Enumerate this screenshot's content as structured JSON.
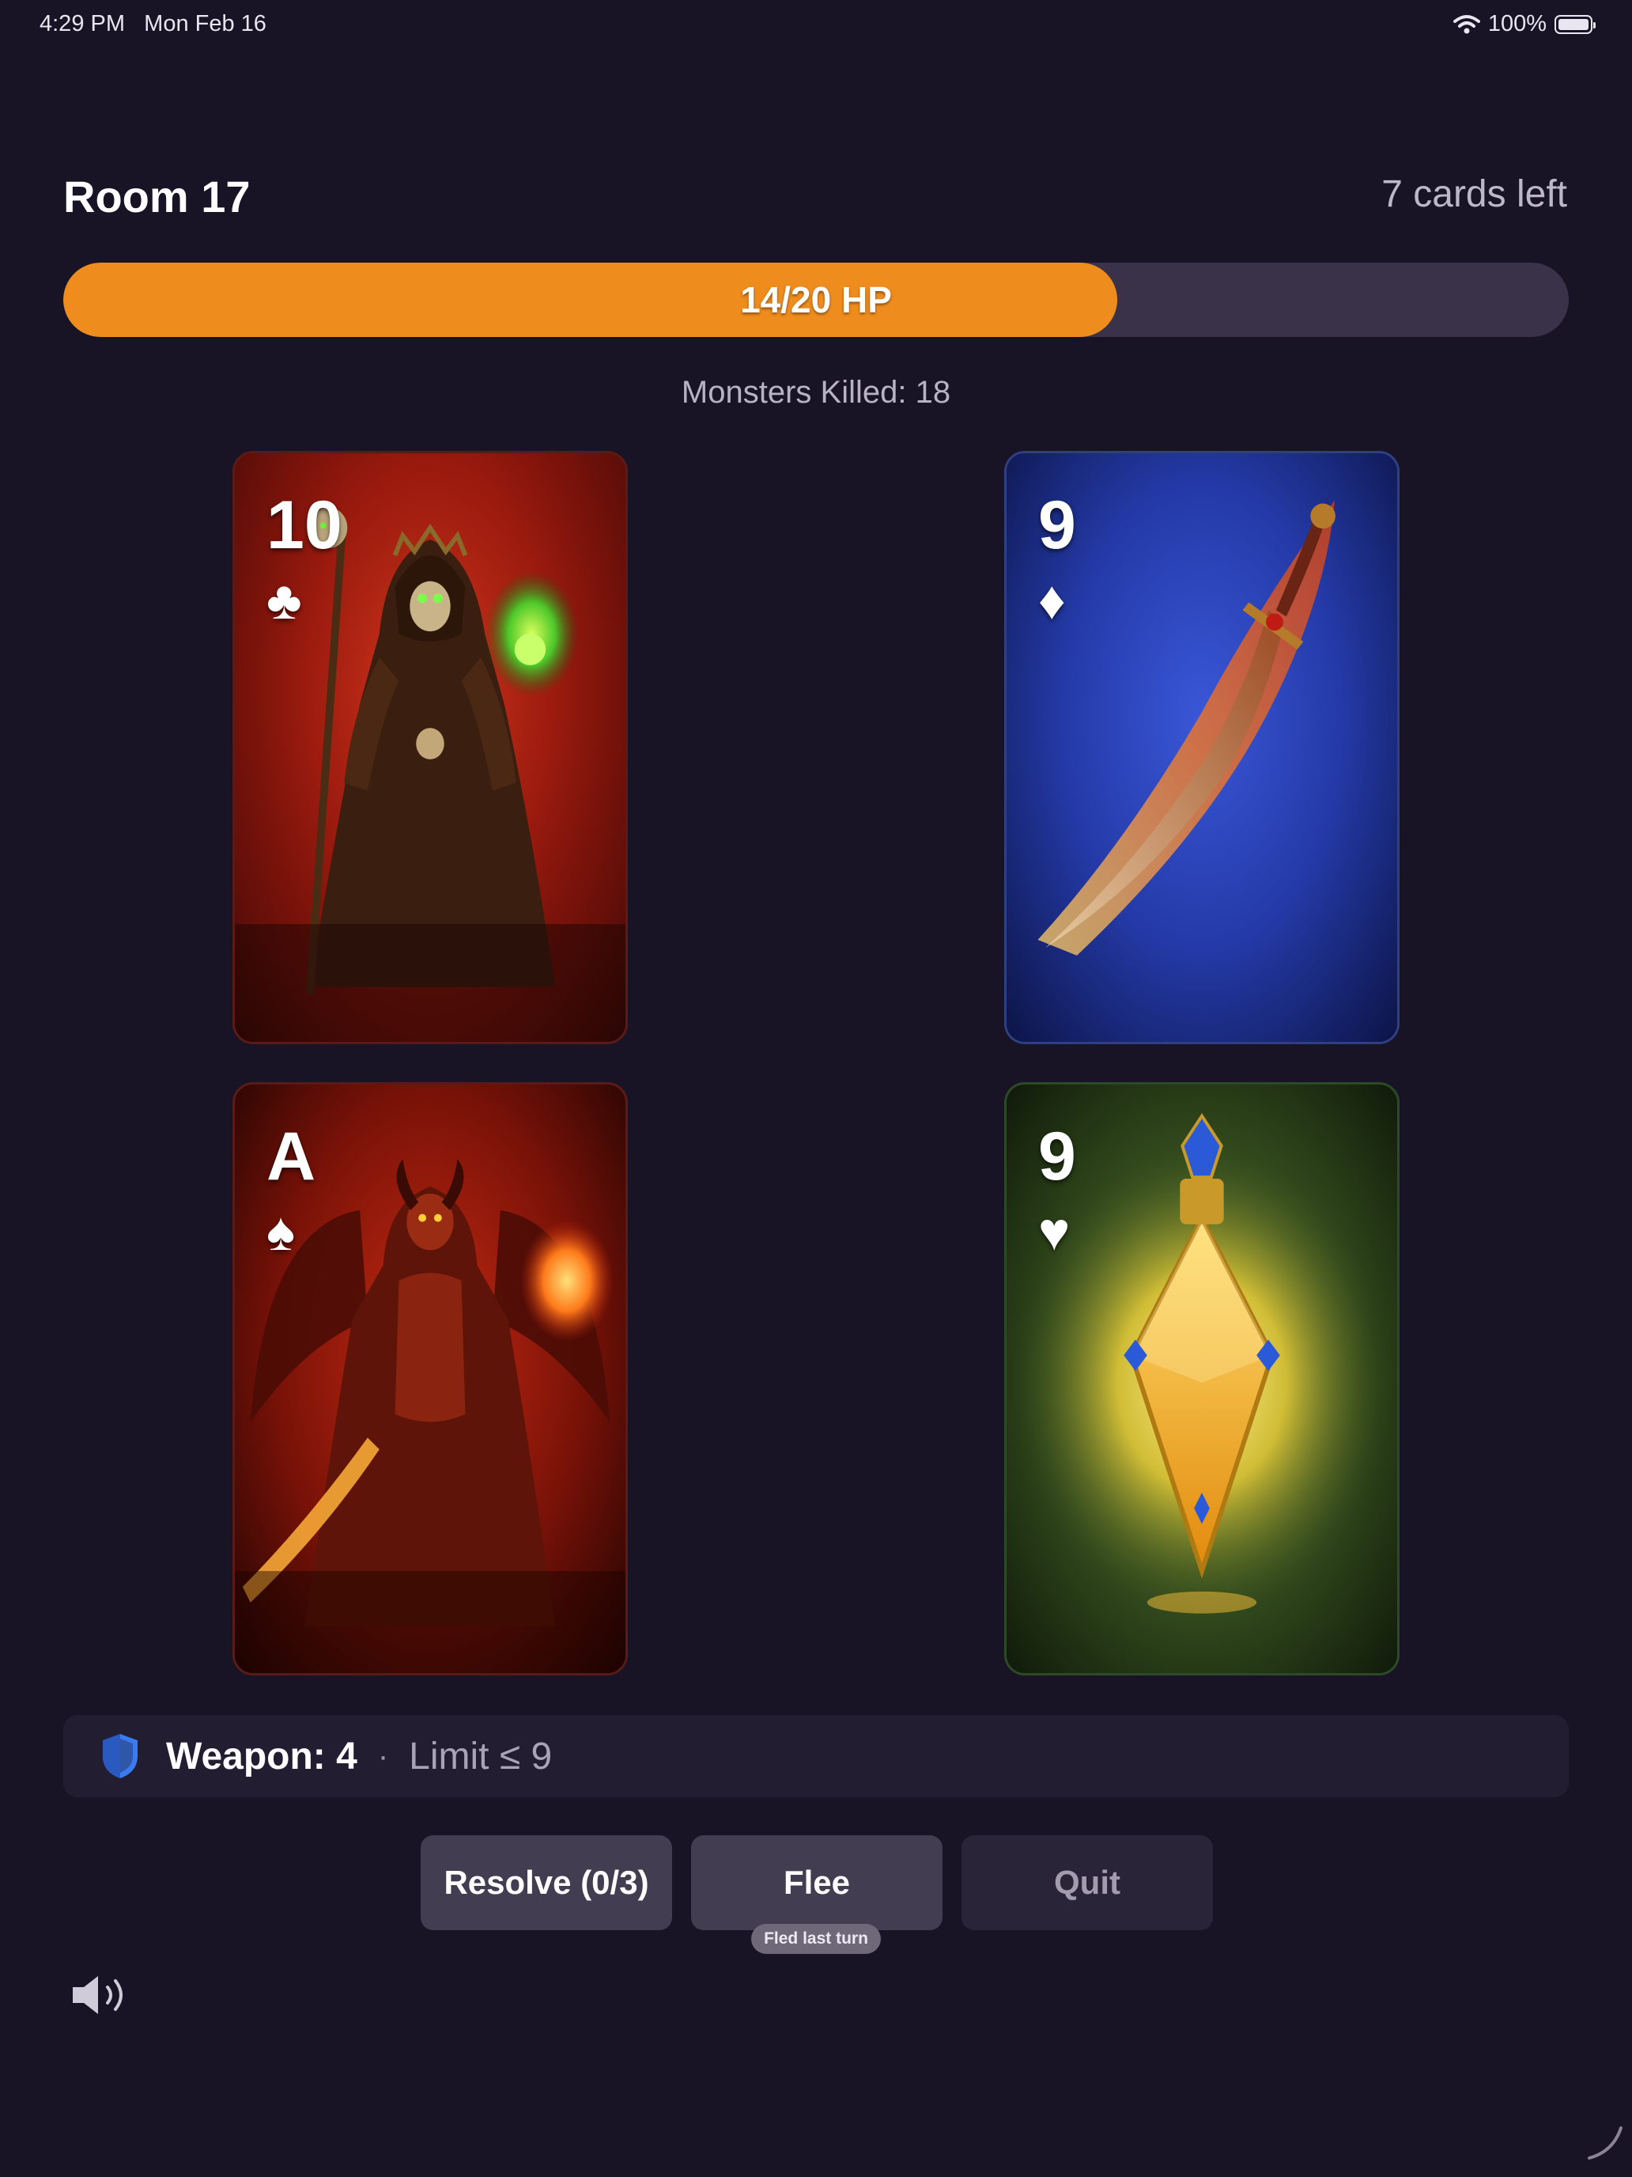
{
  "status": {
    "time": "4:29 PM",
    "date": "Mon Feb 16",
    "battery": "100%",
    "icons": [
      "wifi-icon",
      "battery-icon"
    ]
  },
  "header": {
    "room": "Room 17",
    "cards_left": "7 cards left"
  },
  "hp": {
    "label": "14/20 HP",
    "current": 14,
    "max": 20,
    "fill_fraction": 0.7,
    "color": "#EF8C1E"
  },
  "stats": {
    "monsters_killed": "Monsters Killed: 18"
  },
  "cards": [
    {
      "rank": "10",
      "suit": "♣",
      "art": "hooded-lich-monster",
      "suit_name": "clubs"
    },
    {
      "rank": "9",
      "suit": "♦",
      "art": "flaming-sword-weapon",
      "suit_name": "diamonds"
    },
    {
      "rank": "A",
      "suit": "♠",
      "art": "demon-lord-monster",
      "suit_name": "spades"
    },
    {
      "rank": "9",
      "suit": "♥",
      "art": "golden-potion-heal",
      "suit_name": "hearts"
    }
  ],
  "weapon": {
    "label": "Weapon: 4",
    "separator": "·",
    "limit": "Limit ≤ 9",
    "icon": "shield-icon",
    "icon_color": "#3B7BF0"
  },
  "actions": {
    "resolve": "Resolve (0/3)",
    "flee": "Flee",
    "flee_badge": "Fled last turn",
    "quit": "Quit"
  },
  "controls": {
    "sound_icon": "speaker-icon"
  }
}
